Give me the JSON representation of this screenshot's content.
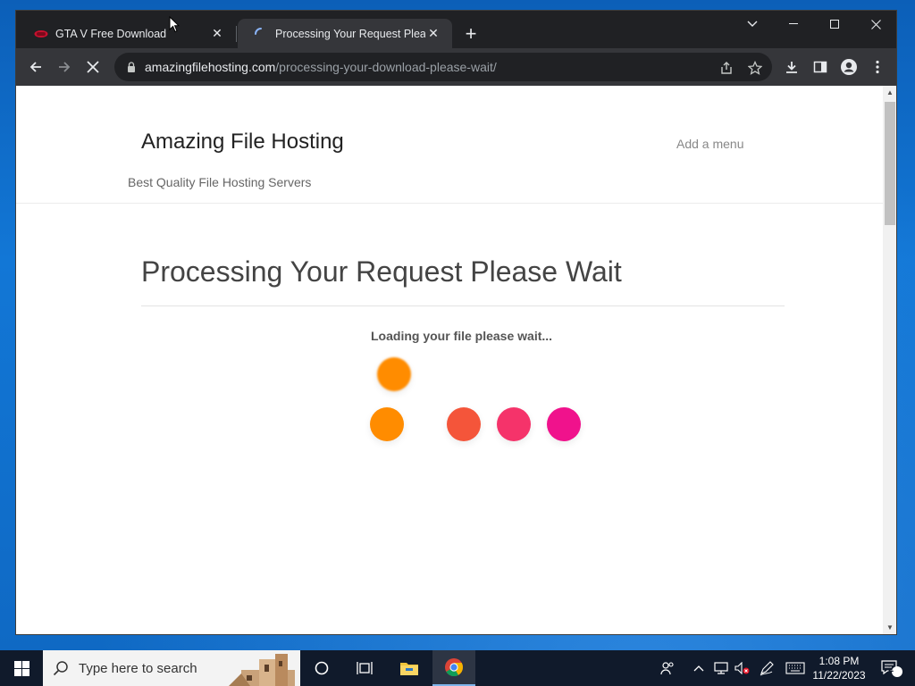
{
  "browser": {
    "tabs": [
      {
        "title": "GTA V Free Download",
        "active": false,
        "favicon": "rockstar-red-icon"
      },
      {
        "title": "Processing Your Request Please",
        "active": true,
        "favicon": "loading-spinner-icon"
      }
    ],
    "address": {
      "domain": "amazingfilehosting.com",
      "path": "/processing-your-download-please-wait/"
    }
  },
  "site": {
    "title": "Amazing File Hosting",
    "tagline": "Best Quality File Hosting Servers",
    "menu_label": "Add a menu"
  },
  "page": {
    "heading": "Processing Your Request Please Wait",
    "loading_text": "Loading your file please wait...",
    "loader_colors": [
      "#ff8c00",
      "#ff8c00",
      "#f4553a",
      "#f5336a",
      "#f0128c"
    ]
  },
  "taskbar": {
    "search_placeholder": "Type here to search",
    "time": "1:08 PM",
    "date": "11/22/2023",
    "notification_count": "2"
  }
}
